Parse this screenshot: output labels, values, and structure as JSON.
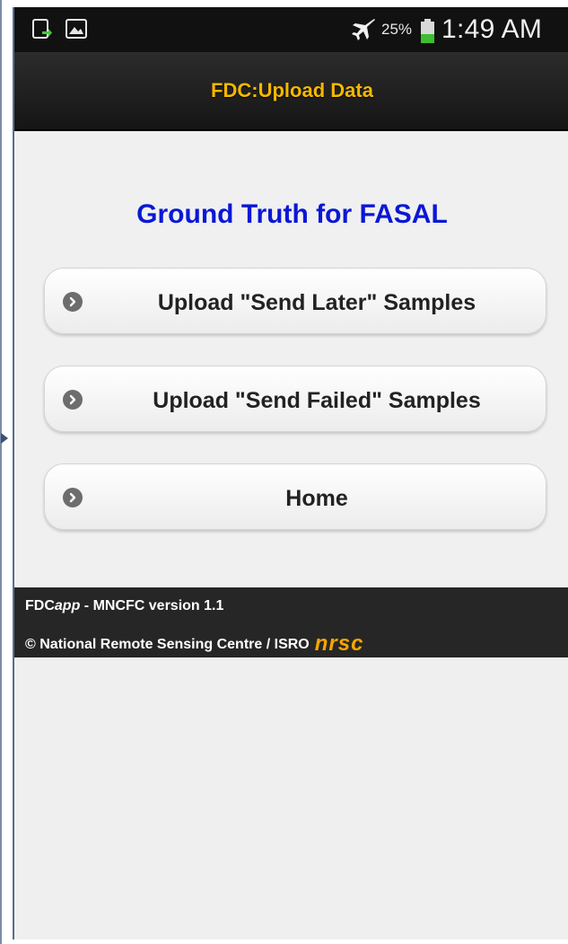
{
  "status_bar": {
    "icons": [
      "screenshot-icon",
      "gallery-icon",
      "airplane-mode-icon",
      "battery-icon"
    ],
    "battery_percent": "25%",
    "time": "1:49 AM"
  },
  "header": {
    "title": "FDC:Upload Data",
    "title_color": "#f5b800"
  },
  "content": {
    "title": "Ground Truth for FASAL",
    "title_color": "#0a17d6",
    "buttons": [
      {
        "label": "Upload \"Send Later\" Samples",
        "icon": "chevron-right-circle-icon"
      },
      {
        "label": "Upload \"Send Failed\" Samples",
        "icon": "chevron-right-circle-icon"
      },
      {
        "label": "Home",
        "icon": "chevron-right-circle-icon"
      }
    ]
  },
  "footer": {
    "app_prefix": "FDC",
    "app_italic": "app",
    "version_text": " - MNCFC version 1.1",
    "copyright": "© National Remote Sensing Centre / ISRO",
    "logo_text": "nrsc",
    "logo_color": "#f6a500"
  }
}
